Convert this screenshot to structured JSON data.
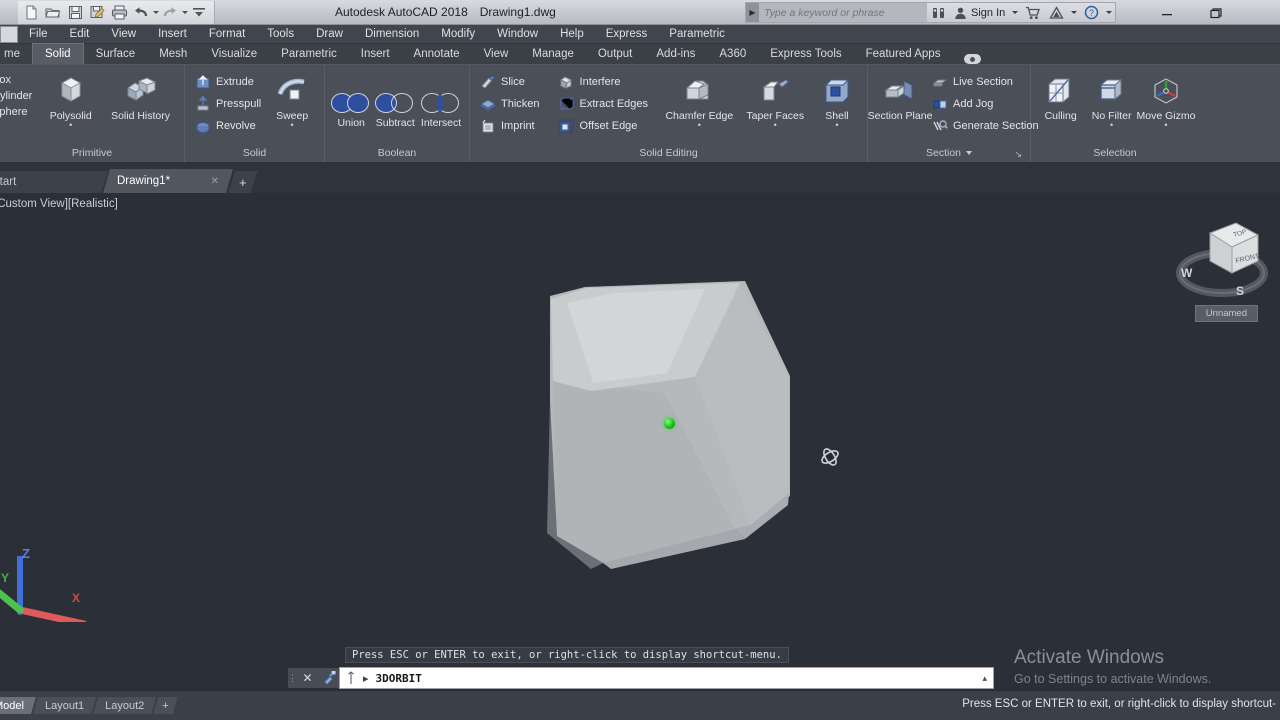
{
  "titlebar": {
    "app_title": "Autodesk AutoCAD 2018",
    "file_name": "Drawing1.dwg",
    "quick_access": [
      {
        "name": "new",
        "label": "New"
      },
      {
        "name": "open",
        "label": "Open"
      },
      {
        "name": "save",
        "label": "Save"
      },
      {
        "name": "save-as",
        "label": "Save As"
      },
      {
        "name": "plot",
        "label": "Plot"
      },
      {
        "name": "undo",
        "label": "Undo"
      },
      {
        "name": "redo",
        "label": "Redo"
      }
    ],
    "search_placeholder": "Type a keyword or phrase",
    "sign_in": "Sign In",
    "window_controls": {
      "minimize": "–",
      "restore": "❐",
      "close": ""
    }
  },
  "menubar": {
    "items": [
      "File",
      "Edit",
      "View",
      "Insert",
      "Format",
      "Tools",
      "Draw",
      "Dimension",
      "Modify",
      "Window",
      "Help",
      "Express",
      "Parametric"
    ]
  },
  "ribbon_tabs": {
    "clipped_first": "me",
    "items": [
      "Solid",
      "Surface",
      "Mesh",
      "Visualize",
      "Parametric",
      "Insert",
      "Annotate",
      "View",
      "Manage",
      "Output",
      "Add-ins",
      "A360",
      "Express Tools",
      "Featured Apps"
    ],
    "active": "Solid"
  },
  "ribbon": {
    "panels": [
      {
        "title": "Primitive",
        "text_items": [
          "Box",
          "Cylinder",
          "Sphere"
        ],
        "big_buttons": [
          {
            "label": "Polysolid",
            "icon": "polysolid-icon",
            "has_dropdown": true
          },
          {
            "label": "Solid History",
            "icon": "solid-history-icon",
            "has_dropdown": false
          }
        ]
      },
      {
        "title": "Solid",
        "small_buttons": [
          {
            "label": "Extrude",
            "icon": "extrude-icon"
          },
          {
            "label": "Presspull",
            "icon": "presspull-icon"
          },
          {
            "label": "Revolve",
            "icon": "revolve-icon"
          }
        ],
        "big_buttons": [
          {
            "label": "Sweep",
            "icon": "sweep-icon",
            "has_dropdown": true
          }
        ]
      },
      {
        "title": "Boolean",
        "big_buttons": [
          {
            "label": "Union",
            "icon": "union-icon",
            "has_dropdown": false
          },
          {
            "label": "Subtract",
            "icon": "subtract-icon",
            "has_dropdown": false
          },
          {
            "label": "Intersect",
            "icon": "intersect-icon",
            "has_dropdown": false
          }
        ]
      },
      {
        "title": "Solid Editing",
        "small_buttons_col1": [
          {
            "label": "Slice",
            "icon": "slice-icon"
          },
          {
            "label": "Thicken",
            "icon": "thicken-icon"
          },
          {
            "label": "Imprint",
            "icon": "imprint-icon"
          }
        ],
        "small_buttons_col2": [
          {
            "label": "Interfere",
            "icon": "interfere-icon"
          },
          {
            "label": "Extract Edges",
            "icon": "extract-edges-icon"
          },
          {
            "label": "Offset Edge",
            "icon": "offset-edge-icon"
          }
        ],
        "big_buttons": [
          {
            "label": "Chamfer Edge",
            "icon": "chamfer-edge-icon",
            "has_dropdown": true
          },
          {
            "label": "Taper Faces",
            "icon": "taper-faces-icon",
            "has_dropdown": true
          },
          {
            "label": "Shell",
            "icon": "shell-icon",
            "has_dropdown": true
          }
        ]
      },
      {
        "title": "Section",
        "has_title_dropdown": true,
        "has_dialog_launcher": true,
        "big_buttons": [
          {
            "label": "Section Plane",
            "icon": "section-plane-icon",
            "has_dropdown": false
          }
        ],
        "small_buttons": [
          {
            "label": "Live Section",
            "icon": "live-section-icon"
          },
          {
            "label": "Add Jog",
            "icon": "add-jog-icon"
          },
          {
            "label": "Generate Section",
            "icon": "generate-section-icon"
          }
        ]
      },
      {
        "title": "Selection",
        "big_buttons": [
          {
            "label": "Culling",
            "icon": "culling-icon",
            "has_dropdown": false
          },
          {
            "label": "No Filter",
            "icon": "no-filter-icon",
            "has_dropdown": true
          },
          {
            "label": "Move Gizmo",
            "icon": "move-gizmo-icon",
            "has_dropdown": true
          }
        ]
      }
    ]
  },
  "file_tabs": {
    "items": [
      {
        "label": "Start",
        "active": false,
        "closable": false
      },
      {
        "label": "Drawing1*",
        "active": true,
        "closable": true
      }
    ],
    "new_tab": "+"
  },
  "viewport": {
    "label": "[Custom View][Realistic]",
    "viewcube": {
      "top_face": "TOP",
      "front_face": "FRONT",
      "compass_west": "W",
      "compass_south": "S",
      "view_name": "Unnamed"
    },
    "ucs": {
      "x": "X",
      "y": "Y",
      "z": "Z"
    },
    "cursor": "3d-orbit-cursor",
    "grip_color": "#1fc01f",
    "background_color": "#2b2f38",
    "solid_color": "#b3b7ba"
  },
  "watermark": {
    "line1": "Activate Windows",
    "line2": "Go to Settings to activate Windows."
  },
  "command_line": {
    "history": "Press ESC or ENTER to exit, or right-click to display shortcut-menu.",
    "prompt": "▸",
    "value": "3DORBIT",
    "close_label": "✕",
    "settings_label": "🔧",
    "expand_label": "▴"
  },
  "statusbar": {
    "layout_tabs": [
      {
        "label": "Model",
        "active": true
      },
      {
        "label": "Layout1",
        "active": false
      },
      {
        "label": "Layout2",
        "active": false
      }
    ],
    "new_layout": "+",
    "message": "Press ESC or ENTER to exit, or right-click to display shortcut-"
  }
}
